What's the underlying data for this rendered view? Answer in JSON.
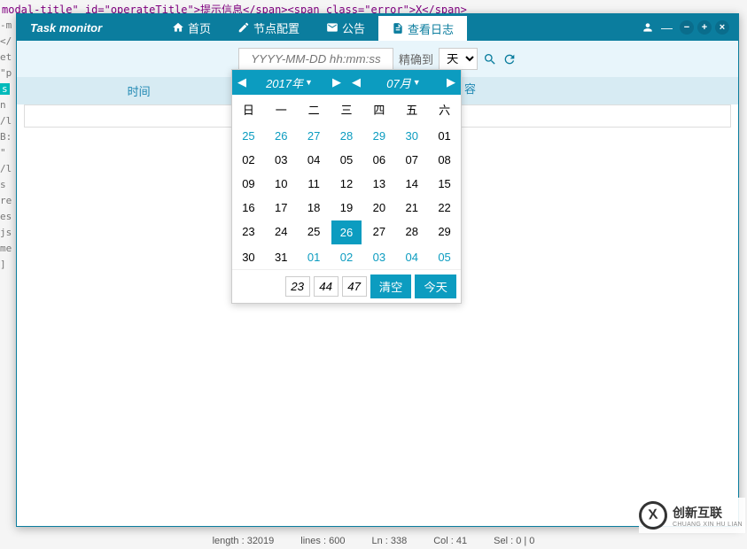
{
  "bg_code": "modal-title\" id=\"operateTitle\">提示信息</span><span class=\"error\">X</span>",
  "app_title": "Task monitor",
  "tabs": {
    "home": "首页",
    "node_config": "节点配置",
    "notice": "公告",
    "view_log": "查看日志"
  },
  "header_user": "—",
  "toolbar": {
    "date_placeholder": "YYYY-MM-DD hh:mm:ss",
    "precision_label": "精确到",
    "precision_value": "天"
  },
  "table": {
    "col_time": "时间",
    "col_content_hint": "容"
  },
  "datepicker": {
    "year_label": "2017年",
    "month_label": "07月",
    "weekdays": [
      "日",
      "一",
      "二",
      "三",
      "四",
      "五",
      "六"
    ],
    "days": [
      {
        "d": 25,
        "o": true
      },
      {
        "d": 26,
        "o": true
      },
      {
        "d": 27,
        "o": true
      },
      {
        "d": 28,
        "o": true
      },
      {
        "d": 29,
        "o": true
      },
      {
        "d": 30,
        "o": true
      },
      {
        "d": "01"
      },
      {
        "d": "02"
      },
      {
        "d": "03"
      },
      {
        "d": "04"
      },
      {
        "d": "05"
      },
      {
        "d": "06"
      },
      {
        "d": "07"
      },
      {
        "d": "08"
      },
      {
        "d": "09"
      },
      {
        "d": 10
      },
      {
        "d": 11
      },
      {
        "d": 12
      },
      {
        "d": 13
      },
      {
        "d": 14
      },
      {
        "d": 15
      },
      {
        "d": 16
      },
      {
        "d": 17
      },
      {
        "d": 18
      },
      {
        "d": 19
      },
      {
        "d": 20
      },
      {
        "d": 21
      },
      {
        "d": 22
      },
      {
        "d": 23
      },
      {
        "d": 24
      },
      {
        "d": 25
      },
      {
        "d": 26,
        "t": true
      },
      {
        "d": 27
      },
      {
        "d": 28
      },
      {
        "d": 29
      },
      {
        "d": 30
      },
      {
        "d": 31
      },
      {
        "d": "01",
        "o": true
      },
      {
        "d": "02",
        "o": true
      },
      {
        "d": "03",
        "o": true
      },
      {
        "d": "04",
        "o": true
      },
      {
        "d": "05",
        "o": true
      }
    ],
    "time": {
      "hh": "23",
      "mm": "44",
      "ss": "47"
    },
    "clear_btn": "清空",
    "today_btn": "今天"
  },
  "left_strip": [
    "-m",
    "</",
    "et",
    "\"p",
    "",
    "s",
    "",
    "n",
    "/l",
    "B:",
    "\"",
    "/l",
    "s",
    "re",
    "es",
    "js",
    "",
    "me",
    "",
    "",
    "",
    "",
    "",
    "",
    "]"
  ],
  "status": {
    "length": "length : 32019",
    "lines": "lines : 600",
    "ln": "Ln : 338",
    "col": "Col : 41",
    "sel": "Sel : 0 | 0"
  },
  "logo": {
    "cn": "创新互联",
    "en": "CHUANG XIN HU LIAN"
  }
}
